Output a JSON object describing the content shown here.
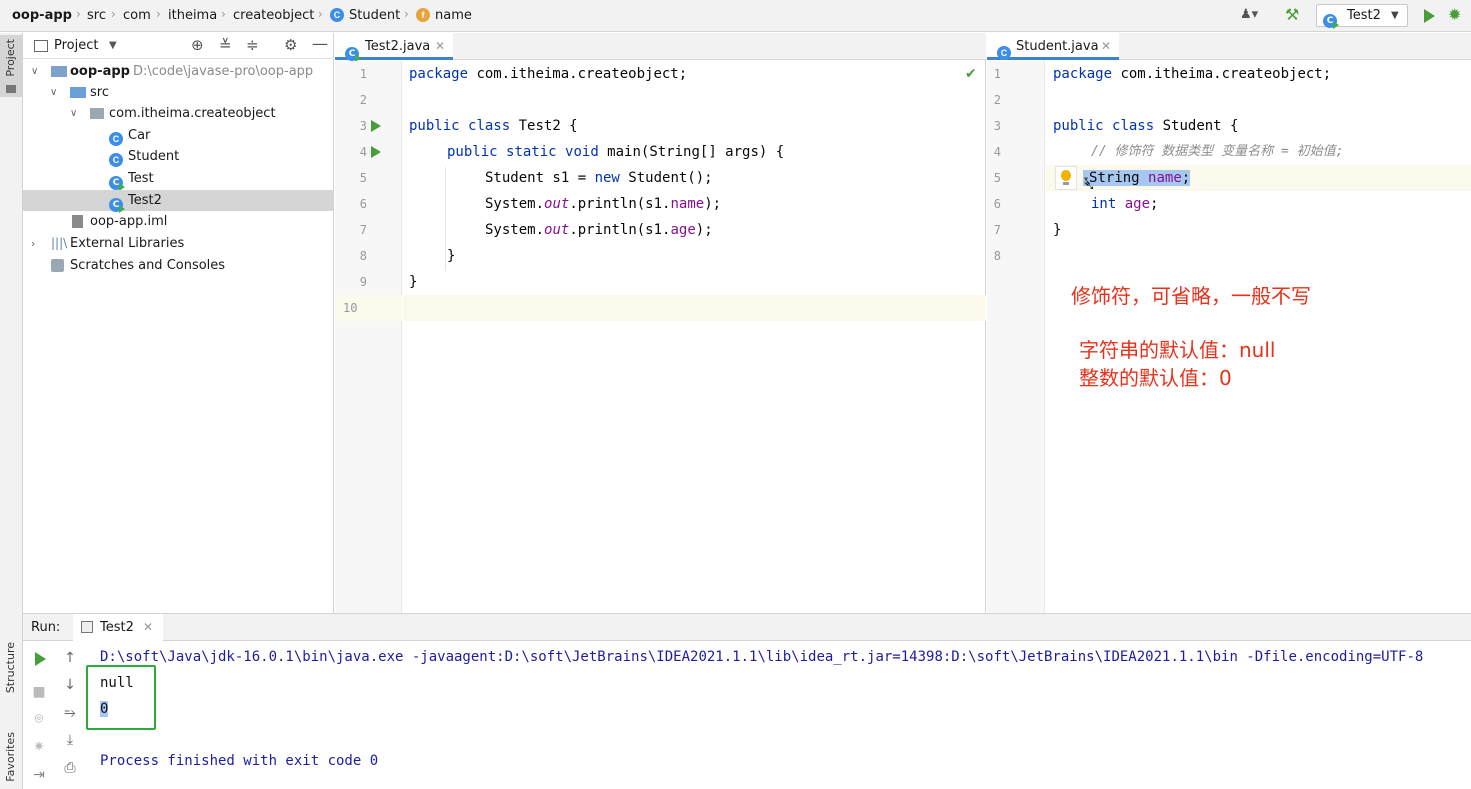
{
  "breadcrumb": {
    "project": "oop-app",
    "items": [
      "src",
      "com",
      "itheima",
      "createobject",
      "Student",
      "name"
    ]
  },
  "toolbar": {
    "run_config": "Test2"
  },
  "side_tabs": {
    "project": "Project",
    "structure": "Structure",
    "favorites": "Favorites"
  },
  "project_panel": {
    "title": "Project",
    "tree": [
      {
        "label": "oop-app",
        "path": "D:\\code\\javase-pro\\oop-app"
      },
      {
        "label": "src"
      },
      {
        "label": "com.itheima.createobject"
      },
      {
        "label": "Car"
      },
      {
        "label": "Student"
      },
      {
        "label": "Test"
      },
      {
        "label": "Test2"
      },
      {
        "label": "oop-app.iml"
      },
      {
        "label": "External Libraries"
      },
      {
        "label": "Scratches and Consoles"
      }
    ]
  },
  "editor_left": {
    "tab": "Test2.java",
    "line_numbers": [
      "1",
      "2",
      "3",
      "4",
      "5",
      "6",
      "7",
      "8",
      "9",
      "10"
    ],
    "lines": {
      "l1": {
        "kw": "package",
        "rest": " com.itheima.createobject;"
      },
      "l3": {
        "kw1": "public",
        "kw2": "class",
        "rest": " Test2 {"
      },
      "l4": {
        "kw1": "public",
        "kw2": "static",
        "kw3": "void",
        "rest": " main(String[] args) {"
      },
      "l5": {
        "a": "Student s1 = ",
        "kw": "new",
        "b": " Student();"
      },
      "l6": {
        "a": "System.",
        "it": "out",
        "b": ".println(s1.",
        "fld": "name",
        "c": ");"
      },
      "l7": {
        "a": "System.",
        "it": "out",
        "b": ".println(s1.",
        "fld": "age",
        "c": ");"
      },
      "l8": "}",
      "l9": "}"
    }
  },
  "editor_right": {
    "tab": "Student.java",
    "line_numbers": [
      "1",
      "2",
      "3",
      "4",
      "5",
      "6",
      "7",
      "8"
    ],
    "lines": {
      "l1": {
        "kw": "package",
        "rest": " com.itheima.createobject;"
      },
      "l3": {
        "kw1": "public",
        "kw2": "class",
        "rest": " Student {"
      },
      "l4": "// 修饰符 数据类型 变量名称 = 初始值;",
      "l5": {
        "type": "String",
        "fld": "name",
        "end": ";"
      },
      "l6": {
        "kw": "int",
        "fld": "age",
        "end": ";"
      },
      "l7": "}"
    }
  },
  "annotations": {
    "modifier": "修饰符，可省略，一般不写",
    "string_default": "字符串的默认值：null",
    "int_default": "整数的默认值：0"
  },
  "run_panel": {
    "label": "Run:",
    "tab": "Test2",
    "command": "D:\\soft\\Java\\jdk-16.0.1\\bin\\java.exe -javaagent:D:\\soft\\JetBrains\\IDEA2021.1.1\\lib\\idea_rt.jar=14398:D:\\soft\\JetBrains\\IDEA2021.1.1\\bin -Dfile.encoding=UTF-8",
    "output": [
      "null",
      "0"
    ],
    "finish": "Process finished with exit code 0"
  },
  "colors": {
    "accent": "#4083c9",
    "run_green": "#4a9d3b",
    "annotation_red": "#e8311a",
    "output_box": "#2eaa3a"
  }
}
